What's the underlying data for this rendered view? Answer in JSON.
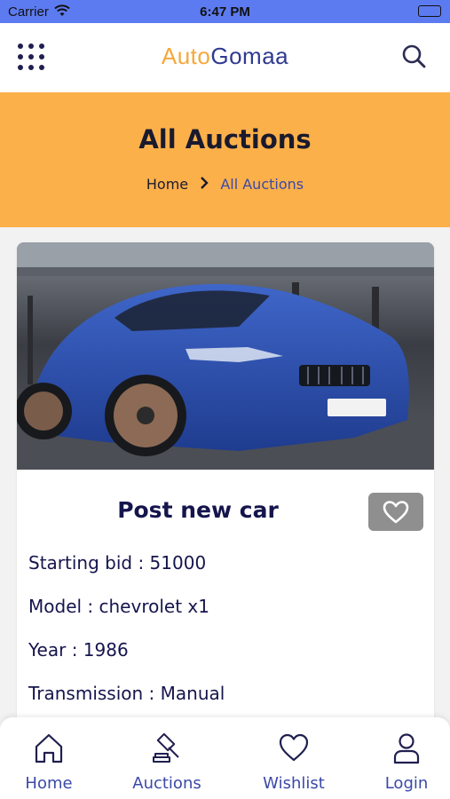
{
  "status_bar": {
    "carrier": "Carrier",
    "time": "6:47 PM"
  },
  "header": {
    "logo_part1": "Auto",
    "logo_part2": "Gomaa",
    "icons": [
      "grid-menu-icon",
      "search-icon"
    ]
  },
  "hero": {
    "title": "All Auctions",
    "breadcrumb_home": "Home",
    "breadcrumb_current": "All Auctions"
  },
  "listing": {
    "title": "Post new car",
    "starting_bid": "Starting bid : 51000",
    "model": "Model : chevrolet x1",
    "year": "Year : 1986",
    "transmission": "Transmission : Manual",
    "image_alt": "blue sports car"
  },
  "tabs": [
    {
      "label": "Home",
      "icon": "home-icon"
    },
    {
      "label": "Auctions",
      "icon": "gavel-icon"
    },
    {
      "label": "Wishlist",
      "icon": "heart-icon"
    },
    {
      "label": "Login",
      "icon": "user-icon"
    }
  ],
  "colors": {
    "status_bar": "#5d7bf0",
    "hero": "#fcb04a",
    "logo_orange": "#f5a83c",
    "logo_blue": "#2f3a8f",
    "accent": "#3b49a8",
    "text_dark": "#15154d"
  }
}
